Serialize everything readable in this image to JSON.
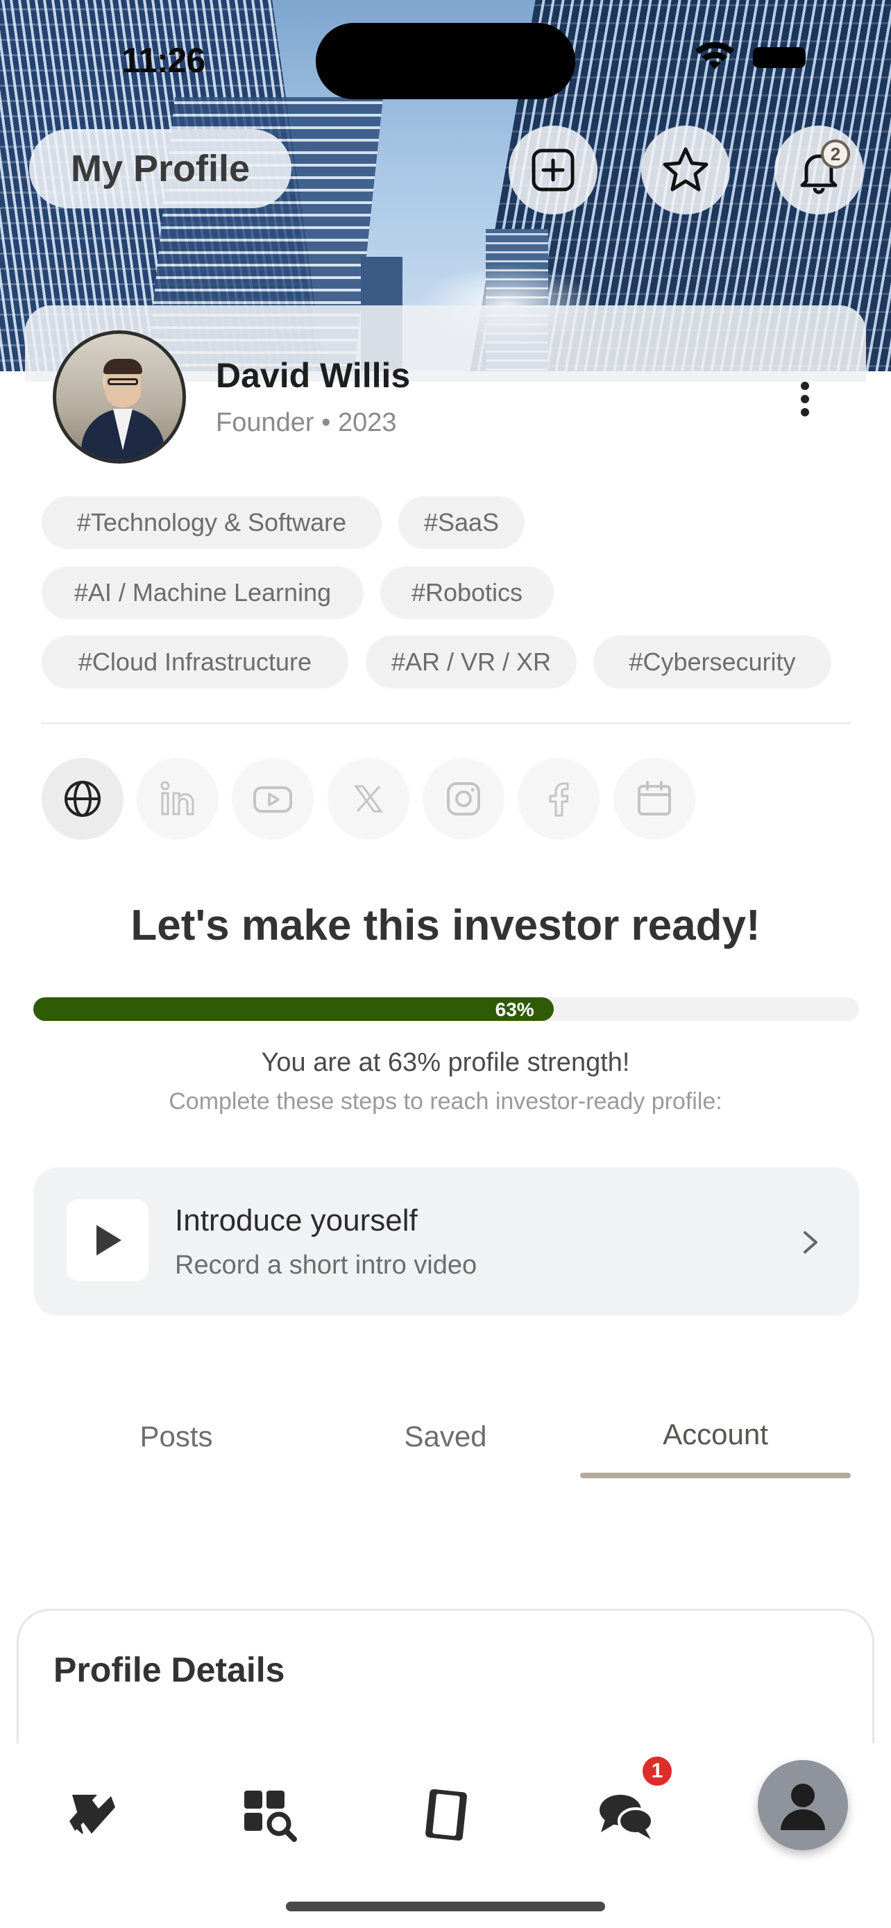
{
  "status_bar": {
    "time": "11:26"
  },
  "header": {
    "title": "My Profile",
    "notification_count": "2"
  },
  "profile": {
    "name": "David Willis",
    "role_year": "Founder • 2023",
    "tags": [
      "#Technology & Software",
      "#SaaS",
      "#AI / Machine Learning",
      "#Robotics",
      "#Cloud Infrastructure",
      "#AR / VR / XR",
      "#Cybersecurity"
    ],
    "social_icons": [
      "globe-icon",
      "linkedin-icon",
      "youtube-icon",
      "x-icon",
      "instagram-icon",
      "facebook-icon",
      "calendar-icon"
    ]
  },
  "readiness": {
    "headline": "Let's make this investor ready!",
    "progress_percent": 63,
    "progress_label": "63%",
    "strength_text": "You are at 63% profile strength!",
    "steps_text": "Complete these steps to reach investor-ready profile:",
    "task": {
      "title": "Introduce yourself",
      "subtitle": "Record a short intro video"
    }
  },
  "tabs": {
    "items": [
      "Posts",
      "Saved",
      "Account"
    ],
    "active": "Account"
  },
  "details": {
    "title": "Profile Details"
  },
  "bottom_nav": {
    "items": [
      "activity-icon",
      "search-grid-icon",
      "cards-icon",
      "chat-icon",
      "profile-icon"
    ],
    "chat_badge": "1"
  },
  "colors": {
    "progress_fill": "#2f5a06",
    "tab_underline": "#b5a99d",
    "badge_red": "#e02b2b"
  }
}
